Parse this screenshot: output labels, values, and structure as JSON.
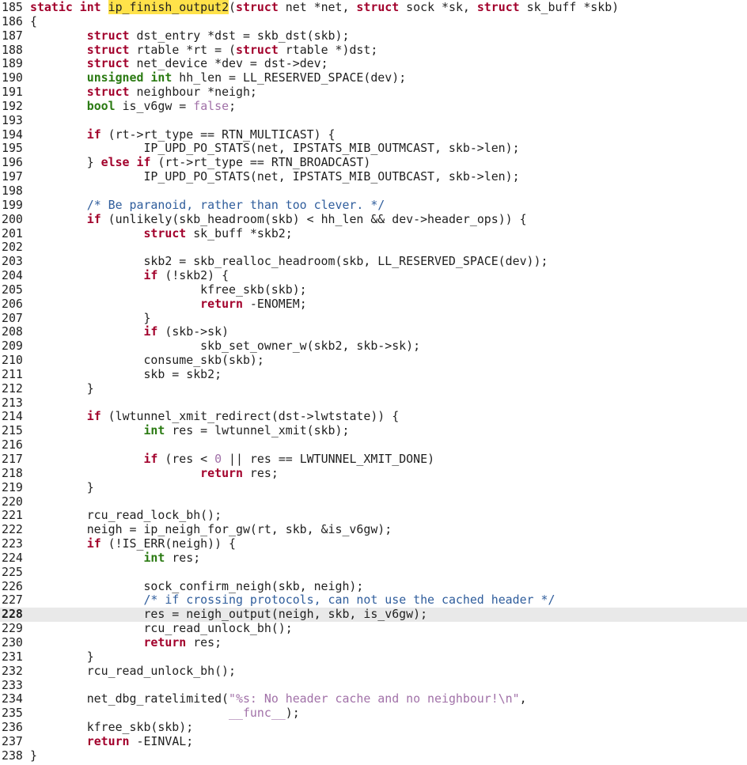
{
  "editor": {
    "current_line": 228,
    "highlight_color": "#ffe24a",
    "lines": [
      {
        "n": "185",
        "segs": [
          [
            "static int ",
            "kw"
          ],
          [
            "ip_finish_output2",
            "fnhl"
          ],
          [
            "(",
            ""
          ],
          [
            "struct",
            "kw"
          ],
          [
            " net *net, ",
            ""
          ],
          [
            "struct",
            "kw"
          ],
          [
            " sock *sk, ",
            ""
          ],
          [
            "struct",
            "kw"
          ],
          [
            " sk_buff *skb)",
            ""
          ]
        ]
      },
      {
        "n": "186",
        "segs": [
          [
            "{",
            ""
          ]
        ]
      },
      {
        "n": "187",
        "segs": [
          [
            "        ",
            ""
          ],
          [
            "struct",
            "kw"
          ],
          [
            " dst_entry *dst = skb_dst(skb);",
            ""
          ]
        ]
      },
      {
        "n": "188",
        "segs": [
          [
            "        ",
            ""
          ],
          [
            "struct",
            "kw"
          ],
          [
            " rtable *rt = (",
            ""
          ],
          [
            "struct",
            "kw"
          ],
          [
            " rtable *)dst;",
            ""
          ]
        ]
      },
      {
        "n": "189",
        "segs": [
          [
            "        ",
            ""
          ],
          [
            "struct",
            "kw"
          ],
          [
            " net_device *dev = dst->dev;",
            ""
          ]
        ]
      },
      {
        "n": "190",
        "segs": [
          [
            "        ",
            ""
          ],
          [
            "unsigned int",
            "ty"
          ],
          [
            " hh_len = LL_RESERVED_SPACE(dev);",
            ""
          ]
        ]
      },
      {
        "n": "191",
        "segs": [
          [
            "        ",
            ""
          ],
          [
            "struct",
            "kw"
          ],
          [
            " neighbour *neigh;",
            ""
          ]
        ]
      },
      {
        "n": "192",
        "segs": [
          [
            "        ",
            ""
          ],
          [
            "bool",
            "ty"
          ],
          [
            " is_v6gw = ",
            ""
          ],
          [
            "false",
            "lit"
          ],
          [
            ";",
            ""
          ]
        ]
      },
      {
        "n": "193",
        "segs": []
      },
      {
        "n": "194",
        "segs": [
          [
            "        ",
            ""
          ],
          [
            "if",
            "kw"
          ],
          [
            " (rt->rt_type == RTN_MULTICAST) {",
            ""
          ]
        ]
      },
      {
        "n": "195",
        "segs": [
          [
            "                IP_UPD_PO_STATS(net, IPSTATS_MIB_OUTMCAST, skb->len);",
            ""
          ]
        ]
      },
      {
        "n": "196",
        "segs": [
          [
            "        } ",
            ""
          ],
          [
            "else if",
            "kw"
          ],
          [
            " (rt->rt_type == RTN_BROADCAST)",
            ""
          ]
        ]
      },
      {
        "n": "197",
        "segs": [
          [
            "                IP_UPD_PO_STATS(net, IPSTATS_MIB_OUTBCAST, skb->len);",
            ""
          ]
        ]
      },
      {
        "n": "198",
        "segs": []
      },
      {
        "n": "199",
        "segs": [
          [
            "        ",
            ""
          ],
          [
            "/* Be paranoid, rather than too clever. */",
            "cm"
          ]
        ]
      },
      {
        "n": "200",
        "segs": [
          [
            "        ",
            ""
          ],
          [
            "if",
            "kw"
          ],
          [
            " (unlikely(skb_headroom(skb) < hh_len && dev->header_ops)) {",
            ""
          ]
        ]
      },
      {
        "n": "201",
        "segs": [
          [
            "                ",
            ""
          ],
          [
            "struct",
            "kw"
          ],
          [
            " sk_buff *skb2;",
            ""
          ]
        ]
      },
      {
        "n": "202",
        "segs": []
      },
      {
        "n": "203",
        "segs": [
          [
            "                skb2 = skb_realloc_headroom(skb, LL_RESERVED_SPACE(dev));",
            ""
          ]
        ]
      },
      {
        "n": "204",
        "segs": [
          [
            "                ",
            ""
          ],
          [
            "if",
            "kw"
          ],
          [
            " (!skb2) {",
            ""
          ]
        ]
      },
      {
        "n": "205",
        "segs": [
          [
            "                        kfree_skb(skb);",
            ""
          ]
        ]
      },
      {
        "n": "206",
        "segs": [
          [
            "                        ",
            ""
          ],
          [
            "return",
            "kw"
          ],
          [
            " -ENOMEM;",
            ""
          ]
        ]
      },
      {
        "n": "207",
        "segs": [
          [
            "                }",
            ""
          ]
        ]
      },
      {
        "n": "208",
        "segs": [
          [
            "                ",
            ""
          ],
          [
            "if",
            "kw"
          ],
          [
            " (skb->sk)",
            ""
          ]
        ]
      },
      {
        "n": "209",
        "segs": [
          [
            "                        skb_set_owner_w(skb2, skb->sk);",
            ""
          ]
        ]
      },
      {
        "n": "210",
        "segs": [
          [
            "                consume_skb(skb);",
            ""
          ]
        ]
      },
      {
        "n": "211",
        "segs": [
          [
            "                skb = skb2;",
            ""
          ]
        ]
      },
      {
        "n": "212",
        "segs": [
          [
            "        }",
            ""
          ]
        ]
      },
      {
        "n": "213",
        "segs": []
      },
      {
        "n": "214",
        "segs": [
          [
            "        ",
            ""
          ],
          [
            "if",
            "kw"
          ],
          [
            " (lwtunnel_xmit_redirect(dst->lwtstate)) {",
            ""
          ]
        ]
      },
      {
        "n": "215",
        "segs": [
          [
            "                ",
            ""
          ],
          [
            "int",
            "ty"
          ],
          [
            " res = lwtunnel_xmit(skb);",
            ""
          ]
        ]
      },
      {
        "n": "216",
        "segs": []
      },
      {
        "n": "217",
        "segs": [
          [
            "                ",
            ""
          ],
          [
            "if",
            "kw"
          ],
          [
            " (res < ",
            ""
          ],
          [
            "0",
            "lit"
          ],
          [
            " || res == LWTUNNEL_XMIT_DONE)",
            ""
          ]
        ]
      },
      {
        "n": "218",
        "segs": [
          [
            "                        ",
            ""
          ],
          [
            "return",
            "kw"
          ],
          [
            " res;",
            ""
          ]
        ]
      },
      {
        "n": "219",
        "segs": [
          [
            "        }",
            ""
          ]
        ]
      },
      {
        "n": "220",
        "segs": []
      },
      {
        "n": "221",
        "segs": [
          [
            "        rcu_read_lock_bh();",
            ""
          ]
        ]
      },
      {
        "n": "222",
        "segs": [
          [
            "        neigh = ip_neigh_for_gw(rt, skb, &is_v6gw);",
            ""
          ]
        ]
      },
      {
        "n": "223",
        "segs": [
          [
            "        ",
            ""
          ],
          [
            "if",
            "kw"
          ],
          [
            " (!IS_ERR(neigh)) {",
            ""
          ]
        ]
      },
      {
        "n": "224",
        "segs": [
          [
            "                ",
            ""
          ],
          [
            "int",
            "ty"
          ],
          [
            " res;",
            ""
          ]
        ]
      },
      {
        "n": "225",
        "segs": []
      },
      {
        "n": "226",
        "segs": [
          [
            "                sock_confirm_neigh(skb, neigh);",
            ""
          ]
        ]
      },
      {
        "n": "227",
        "segs": [
          [
            "                ",
            ""
          ],
          [
            "/* if crossing protocols, can not use the cached header */",
            "cm"
          ]
        ]
      },
      {
        "n": "228",
        "segs": [
          [
            "                res = neigh_output(neigh, skb, is_v6gw);",
            ""
          ]
        ]
      },
      {
        "n": "229",
        "segs": [
          [
            "                rcu_read_unlock_bh();",
            ""
          ]
        ]
      },
      {
        "n": "230",
        "segs": [
          [
            "                ",
            ""
          ],
          [
            "return",
            "kw"
          ],
          [
            " res;",
            ""
          ]
        ]
      },
      {
        "n": "231",
        "segs": [
          [
            "        }",
            ""
          ]
        ]
      },
      {
        "n": "232",
        "segs": [
          [
            "        rcu_read_unlock_bh();",
            ""
          ]
        ]
      },
      {
        "n": "233",
        "segs": []
      },
      {
        "n": "234",
        "segs": [
          [
            "        net_dbg_ratelimited(",
            ""
          ],
          [
            "\"%s: No header cache and no neighbour!\\n\"",
            "st"
          ],
          [
            ",",
            ""
          ]
        ]
      },
      {
        "n": "235",
        "segs": [
          [
            "                            ",
            ""
          ],
          [
            "__func__",
            "lit"
          ],
          [
            ");",
            ""
          ]
        ]
      },
      {
        "n": "236",
        "segs": [
          [
            "        kfree_skb(skb);",
            ""
          ]
        ]
      },
      {
        "n": "237",
        "segs": [
          [
            "        ",
            ""
          ],
          [
            "return",
            "kw"
          ],
          [
            " -EINVAL;",
            ""
          ]
        ]
      },
      {
        "n": "238",
        "segs": [
          [
            "}",
            ""
          ]
        ]
      }
    ]
  }
}
